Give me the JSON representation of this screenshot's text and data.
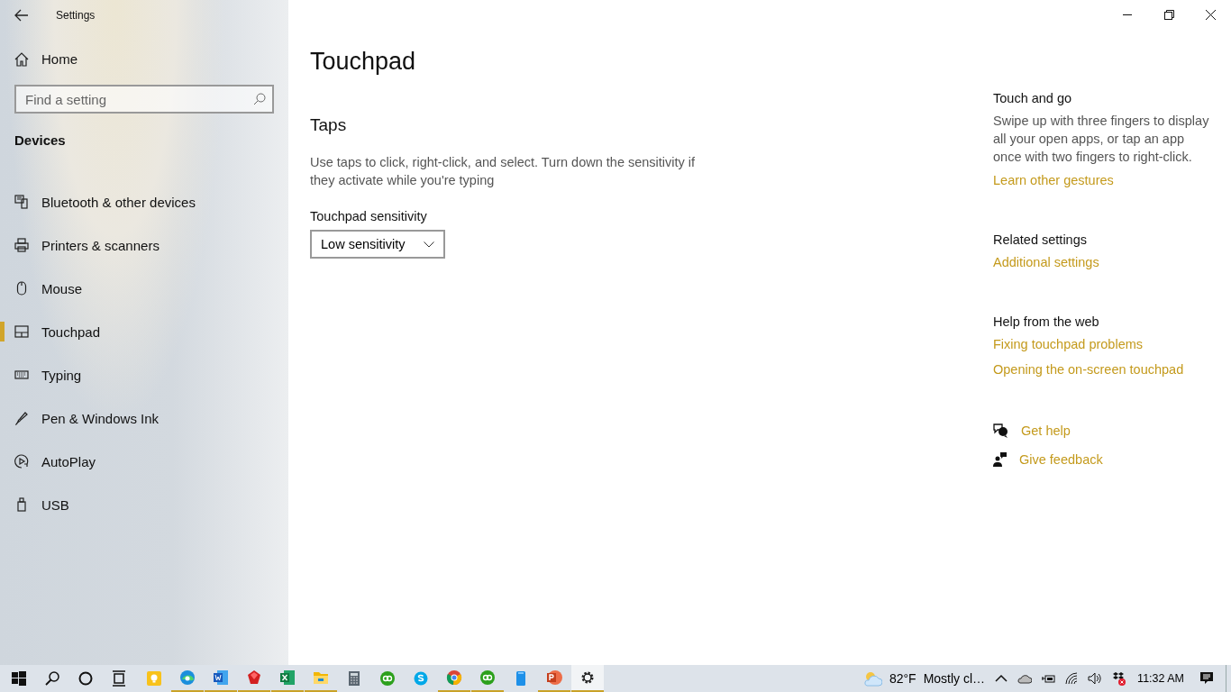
{
  "window": {
    "title": "Settings"
  },
  "sidebar": {
    "home": "Home",
    "search": {
      "placeholder": "Find a setting"
    },
    "section": "Devices",
    "items": [
      {
        "label": "Bluetooth & other devices",
        "kind": "devices",
        "selected": false
      },
      {
        "label": "Printers & scanners",
        "kind": "printer",
        "selected": false
      },
      {
        "label": "Mouse",
        "kind": "mouse",
        "selected": false
      },
      {
        "label": "Touchpad",
        "kind": "touchpad",
        "selected": true
      },
      {
        "label": "Typing",
        "kind": "keyboard",
        "selected": false
      },
      {
        "label": "Pen & Windows Ink",
        "kind": "pen",
        "selected": false
      },
      {
        "label": "AutoPlay",
        "kind": "autoplay",
        "selected": false
      },
      {
        "label": "USB",
        "kind": "usb",
        "selected": false
      }
    ]
  },
  "page": {
    "title": "Touchpad",
    "section": "Taps",
    "description": "Use taps to click, right-click, and select. Turn down the sensitivity if they activate while you're typing",
    "field_label": "Touchpad sensitivity",
    "dropdown": {
      "value": "Low sensitivity"
    }
  },
  "aside": {
    "sections": [
      {
        "heading": "Touch and go",
        "text": "Swipe up with three fingers to display all your open apps, or tap an app once with two fingers to right-click.",
        "links": [
          "Learn other gestures"
        ]
      },
      {
        "heading": "Related settings",
        "links": [
          "Additional settings"
        ]
      },
      {
        "heading": "Help from the web",
        "links": [
          "Fixing touchpad problems",
          "Opening the on-screen touchpad"
        ]
      }
    ],
    "help_links": [
      {
        "kind": "help",
        "label": "Get help"
      },
      {
        "kind": "feedback",
        "label": "Give feedback"
      }
    ]
  },
  "taskbar": {
    "apps": [
      {
        "kind": "notes",
        "running": false,
        "selected": false
      },
      {
        "kind": "edge",
        "running": true,
        "selected": false
      },
      {
        "kind": "word",
        "running": true,
        "selected": false
      },
      {
        "kind": "gem",
        "running": true,
        "selected": false
      },
      {
        "kind": "excel",
        "running": true,
        "selected": false
      },
      {
        "kind": "folder",
        "running": true,
        "selected": false
      },
      {
        "kind": "calculator",
        "running": false,
        "selected": false
      },
      {
        "kind": "qb",
        "running": false,
        "selected": false
      },
      {
        "kind": "skype",
        "running": false,
        "selected": false
      },
      {
        "kind": "chrome",
        "running": true,
        "selected": false
      },
      {
        "kind": "qb",
        "running": true,
        "selected": false
      },
      {
        "kind": "phone",
        "running": false,
        "selected": false
      },
      {
        "kind": "powerpoint",
        "running": true,
        "selected": false
      },
      {
        "kind": "settings",
        "running": true,
        "selected": true
      }
    ],
    "weather": {
      "temperature": "82°F",
      "condition": "Mostly cl…"
    },
    "clock": "11:32 AM"
  }
}
